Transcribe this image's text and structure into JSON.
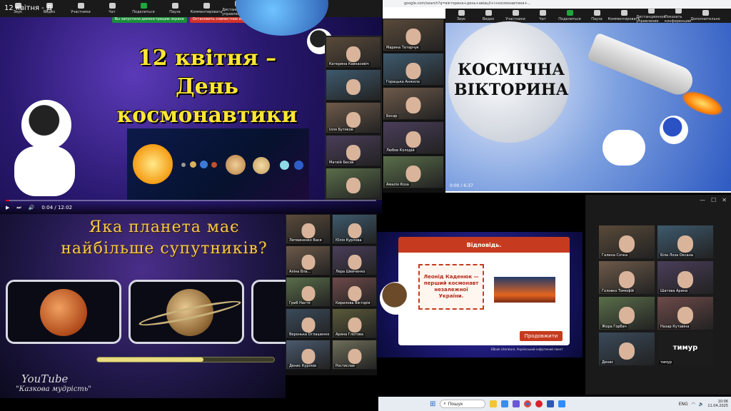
{
  "panel1": {
    "window_title": "12 квітня - Д",
    "slide_title_lines": [
      "12 квітня –",
      "День",
      "космонавтики"
    ],
    "time": "0:04 / 12:02",
    "toolbar": [
      {
        "label": "Звук",
        "icon": "microphone-icon"
      },
      {
        "label": "Видео",
        "icon": "camera-icon"
      },
      {
        "label": "Участники",
        "icon": "people-icon"
      },
      {
        "label": "Чат",
        "icon": "chat-icon"
      },
      {
        "label": "Поделиться",
        "icon": "share-icon"
      },
      {
        "label": "Пауза",
        "icon": "pause-icon"
      },
      {
        "label": "Комментировать",
        "icon": "pencil-icon"
      },
      {
        "label": "Дистанционное управление",
        "icon": "mouse-icon"
      },
      {
        "label": "Показать конференцию",
        "icon": "monitor-icon"
      },
      {
        "label": "Дополнительно",
        "icon": "more-icon"
      }
    ],
    "share_banner": "Вы запустили демонстрацию экрана",
    "stop_banner": "Остановить совместное использование",
    "participants": [
      "Катерина Кавкасевіч",
      "",
      "Ілля Бутяков",
      "Матвій Бесак",
      ""
    ],
    "progress_fraction": 0.01
  },
  "panel3": {
    "url_text": "google.com/search?q=вікторина+день+авіації+і+космонавтики+...",
    "quiz_title_lines": [
      "КОСМІЧНА",
      "ВІКТОРИНА"
    ],
    "time": "0:00 / 6:37",
    "participants": [
      "Марина Татарчук",
      "Горацька Анжела",
      "Босар",
      "Любов Колодій",
      "Амалія Коза"
    ],
    "share_banner": "Вы запустили демонстрацию экрана",
    "stop_banner": "Остановить совместное использование"
  },
  "panel4": {
    "title_lines": [
      "Яка планета має",
      "найбільше супутників?"
    ],
    "logo": "YouTube",
    "subtitle": "\"Казкова мудрість\"",
    "progress_fraction": 0.6
  },
  "panel5": {
    "participants": [
      "Литвиненко Вася",
      "Юлія Курлова",
      "Аліна Вла...",
      "Лера Шевченко",
      "Гриб Настя",
      "Кирилова Вікторія",
      "Веронька Оглашенко",
      "Арина Глотова",
      "Денис Курілов",
      "Ростислав"
    ],
    "caption_extra": "Ростислав коваль"
  },
  "panel6": {
    "header": "Відповідь.",
    "answer": "Леонід Каденюк — перший космонавт незалежної України.",
    "button": "Продовжити",
    "footer": "EBook Literature, Український інфіртмний пакет"
  },
  "panel7": {
    "participants": [
      "Галина Сочка",
      "Біла Лоза Оксана",
      "Головко Тимофій",
      "Шатова Арина",
      "Жора Горбач",
      "Назар Кутавіна",
      "Денис",
      "тимур"
    ],
    "big_label": "тимур"
  },
  "taskbar": {
    "search_placeholder": "Пошук",
    "lang": "ENG",
    "time": "10:06",
    "date": "11.04.2025"
  }
}
